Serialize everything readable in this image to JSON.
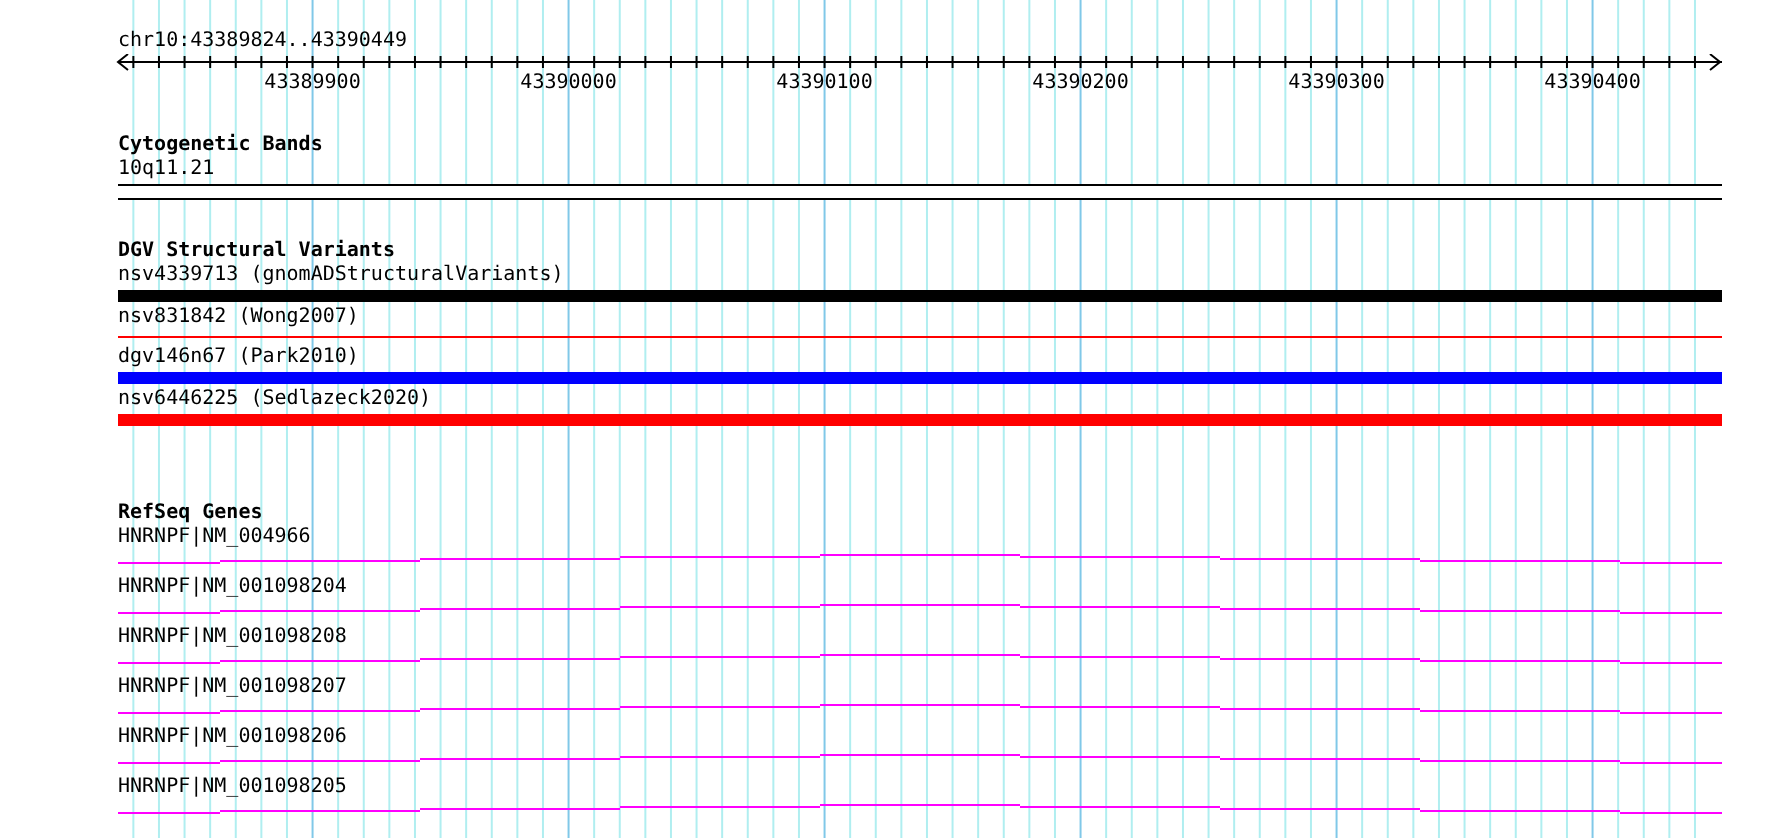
{
  "ruler": {
    "range": "chr10:43389824..43390449",
    "tick_labels": [
      "43389900",
      "43390000",
      "43390100",
      "43390200",
      "43390300",
      "43390400"
    ]
  },
  "cytogenetic_bands": {
    "title": "Cytogenetic Bands",
    "features": [
      {
        "label": "10q11.21"
      }
    ]
  },
  "dgv_structural_variants": {
    "title": "DGV Structural Variants",
    "features": [
      {
        "label": "nsv4339713 (gnomADStructuralVariants)",
        "kind": "thick",
        "color": "#000000"
      },
      {
        "label": "nsv831842 (Wong2007)",
        "kind": "thin",
        "color": "#ff0000"
      },
      {
        "label": "dgv146n67 (Park2010)",
        "kind": "thick",
        "color": "#0000ff"
      },
      {
        "label": "nsv6446225 (Sedlazeck2020)",
        "kind": "thick",
        "color": "#ff0000"
      }
    ]
  },
  "refseq_genes": {
    "title": "RefSeq Genes",
    "features": [
      {
        "label": "HNRNPF|NM_004966"
      },
      {
        "label": "HNRNPF|NM_001098204"
      },
      {
        "label": "HNRNPF|NM_001098208"
      },
      {
        "label": "HNRNPF|NM_001098207"
      },
      {
        "label": "HNRNPF|NM_001098206"
      },
      {
        "label": "HNRNPF|NM_001098205"
      }
    ]
  }
}
